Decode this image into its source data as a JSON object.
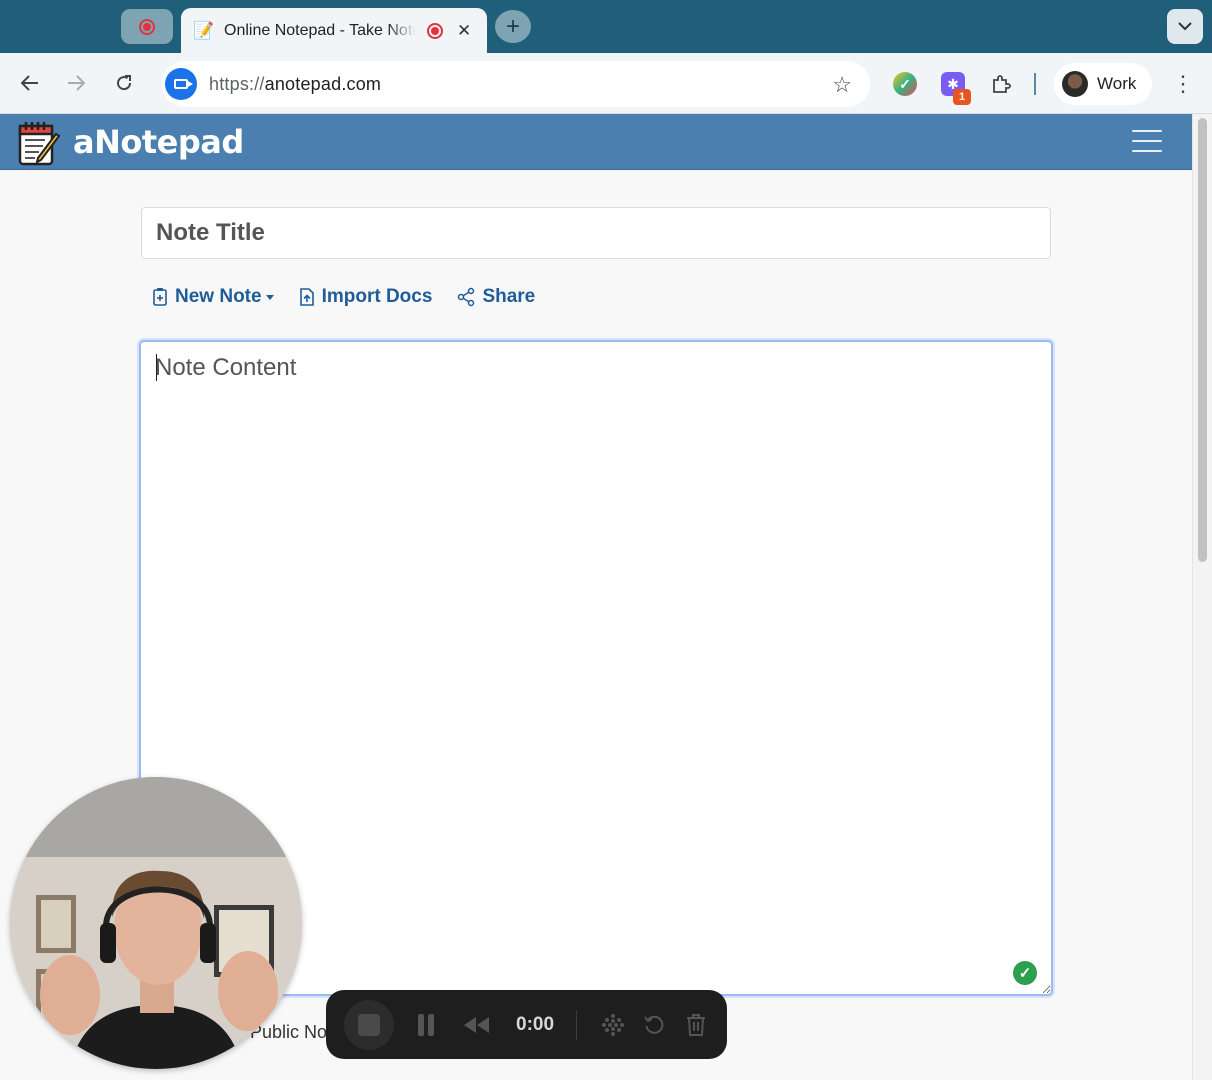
{
  "browser": {
    "tab": {
      "title": "Online Notepad - Take Notes",
      "favicon": "notepad-favicon-icon",
      "close": "✕"
    },
    "new_tab": "+",
    "tab_search": "chevron-down-icon",
    "url": {
      "scheme": "https://",
      "host": "anotepad.com"
    },
    "extensions": [
      {
        "name": "grammar-check-extension-icon"
      },
      {
        "name": "ai-extension-icon",
        "badge": "1"
      },
      {
        "name": "puzzle-extensions-icon"
      }
    ],
    "profile": {
      "label": "Work"
    }
  },
  "app": {
    "brand": "aNotepad",
    "menu_icon": "hamburger-menu-icon",
    "title_placeholder": "Note Title",
    "actions": {
      "new_note": "New Note",
      "import_docs": "Import Docs",
      "share": "Share"
    },
    "content_placeholder": "Note Content",
    "public_note_label": "Public Note"
  },
  "recorder": {
    "timer": "0:00"
  },
  "colors": {
    "tabbar": "#1f5f7a",
    "navbar": "#4a7fb0",
    "link": "#1f5d99",
    "focus_border": "#9bbcf2"
  }
}
